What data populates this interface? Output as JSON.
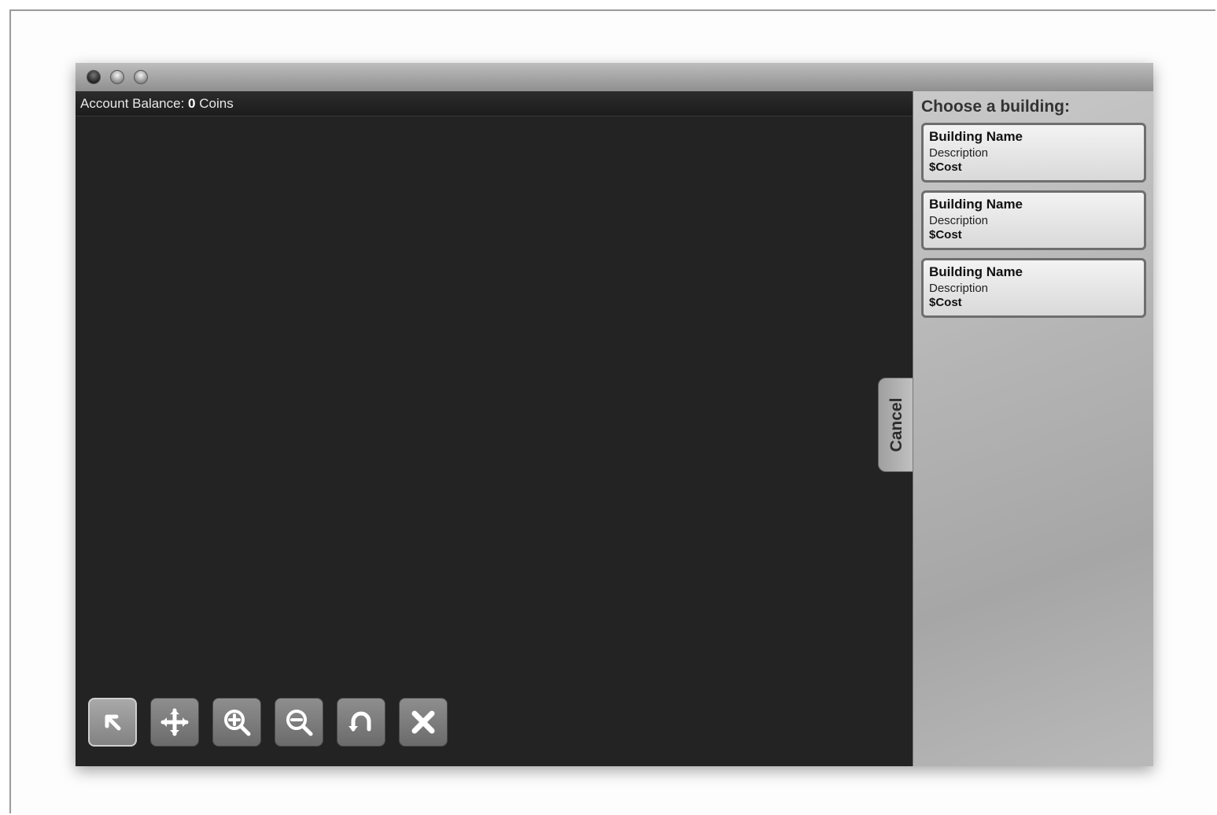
{
  "status_bar": {
    "balance_label": "Account Balance:",
    "balance_value": "0",
    "balance_unit": "Coins"
  },
  "sidebar": {
    "title": "Choose a building:",
    "buildings": [
      {
        "name": "Building Name",
        "description": "Description",
        "cost": "$Cost"
      },
      {
        "name": "Building Name",
        "description": "Description",
        "cost": "$Cost"
      },
      {
        "name": "Building Name",
        "description": "Description",
        "cost": "$Cost"
      }
    ],
    "cancel_label": "Cancel"
  },
  "toolbar": {
    "tools": [
      {
        "icon": "select-arrow-icon",
        "active": true
      },
      {
        "icon": "move-icon",
        "active": false
      },
      {
        "icon": "zoom-in-icon",
        "active": false
      },
      {
        "icon": "zoom-out-icon",
        "active": false
      },
      {
        "icon": "rotate-icon",
        "active": false
      },
      {
        "icon": "delete-icon",
        "active": false
      }
    ]
  },
  "colors": {
    "game_background": "#232323",
    "sidebar_background": "#b4b4b4",
    "tool_button": "#7a7a7a"
  }
}
